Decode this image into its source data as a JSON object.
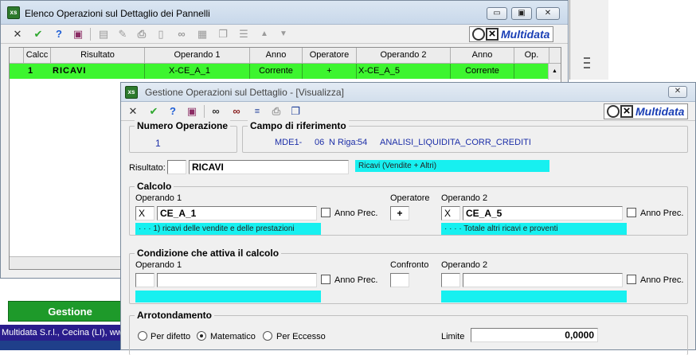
{
  "bg_window": {
    "title": "Elenco Operazioni sul Dettaglio dei Pannelli",
    "app_icon": "xs",
    "caption_buttons": {
      "minimize": "▭",
      "restore": "▣",
      "close": "✕"
    },
    "brand": "Multidata",
    "grid": {
      "headers": [
        "Calcc",
        "Risultato",
        "Operando 1",
        "Anno",
        "Operatore",
        "Operando 2",
        "Anno",
        "Op."
      ],
      "row": {
        "calc": "1",
        "risultato": "RICAVI",
        "operando1": "X-CE_A_1",
        "anno1": "Corrente",
        "operatore": "+",
        "operando2": "X-CE_A_5",
        "anno2": "Corrente",
        "op": ""
      }
    },
    "gestione_button": "Gestione",
    "statusbar": "Multidata S.r.l., Cecina (LI), www."
  },
  "dialog": {
    "title": "Gestione Operazioni sul Dettaglio - [Visualizza]",
    "app_icon": "xs",
    "close": "✕",
    "brand": "Multidata",
    "numero_operazione": {
      "label": "Numero Operazione",
      "value": "1"
    },
    "campo_riferimento": {
      "label": "Campo di riferimento",
      "code": "MDE1-",
      "num": "06",
      "riga_label": "N Riga:",
      "riga": "54",
      "name": "ANALISI_LIQUIDITA_CORR_CREDITI"
    },
    "risultato": {
      "label": "Risultato:",
      "prefix": "",
      "value": "RICAVI",
      "description": "Ricavi (Vendite + Altri)"
    },
    "calcolo": {
      "label": "Calcolo",
      "operando1": {
        "label": "Operando 1",
        "prefix": "X",
        "value": "CE_A_1",
        "description": "· · · 1) ricavi delle vendite e delle prestazioni"
      },
      "anno_prec": "Anno Prec.",
      "operatore": {
        "label": "Operatore",
        "value": "+"
      },
      "operando2": {
        "label": "Operando 2",
        "prefix": "X",
        "value": "CE_A_5",
        "description": "· · · · Totale altri ricavi e proventi"
      }
    },
    "condizione": {
      "label": "Condizione che attiva il calcolo",
      "operando1": {
        "label": "Operando 1",
        "prefix": "",
        "value": "",
        "description": ""
      },
      "anno_prec": "Anno Prec.",
      "confronto": {
        "label": "Confronto",
        "value": ""
      },
      "operando2": {
        "label": "Operando 2",
        "prefix": "",
        "value": "",
        "description": ""
      }
    },
    "arrotondamento": {
      "label": "Arrotondamento",
      "options": [
        "Per difetto",
        "Matematico",
        "Per Eccesso"
      ],
      "selected": "Matematico",
      "limite_label": "Limite",
      "limite_value": "0,0000"
    }
  }
}
